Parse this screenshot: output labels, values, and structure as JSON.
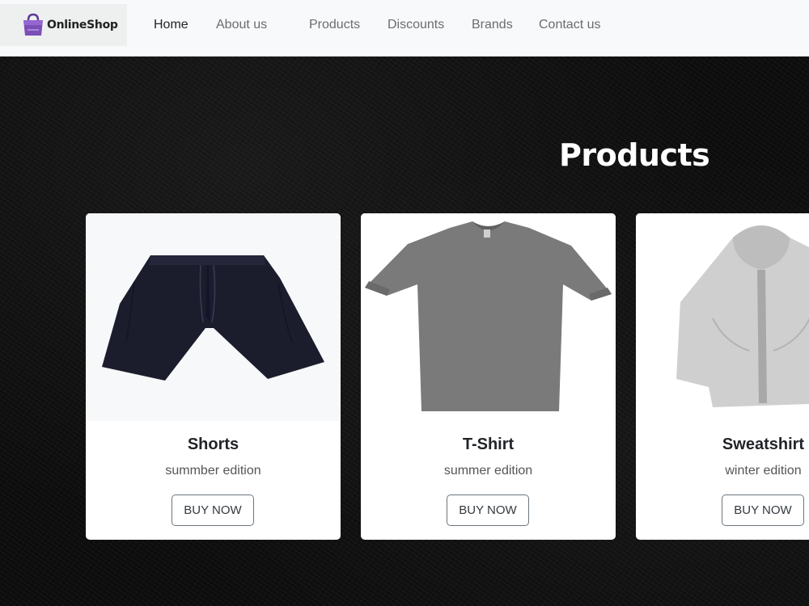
{
  "brand": {
    "name": "OnlineShop",
    "accent": "#7b4fb5"
  },
  "nav": {
    "items": [
      {
        "label": "Home",
        "active": true
      },
      {
        "label": "About us"
      },
      {
        "label": "Products"
      },
      {
        "label": "Discounts"
      },
      {
        "label": "Brands"
      },
      {
        "label": "Contact us"
      }
    ]
  },
  "section": {
    "title": "Products"
  },
  "products": [
    {
      "name": "Shorts",
      "edition": "summber edition",
      "button": "BUY NOW",
      "image": "shorts-image"
    },
    {
      "name": "T-Shirt",
      "edition": "summer edition",
      "button": "BUY NOW",
      "image": "tshirt-image"
    },
    {
      "name": "Sweatshirt",
      "edition": "winter edition",
      "button": "BUY NOW",
      "image": "sweatshirt-image"
    }
  ]
}
